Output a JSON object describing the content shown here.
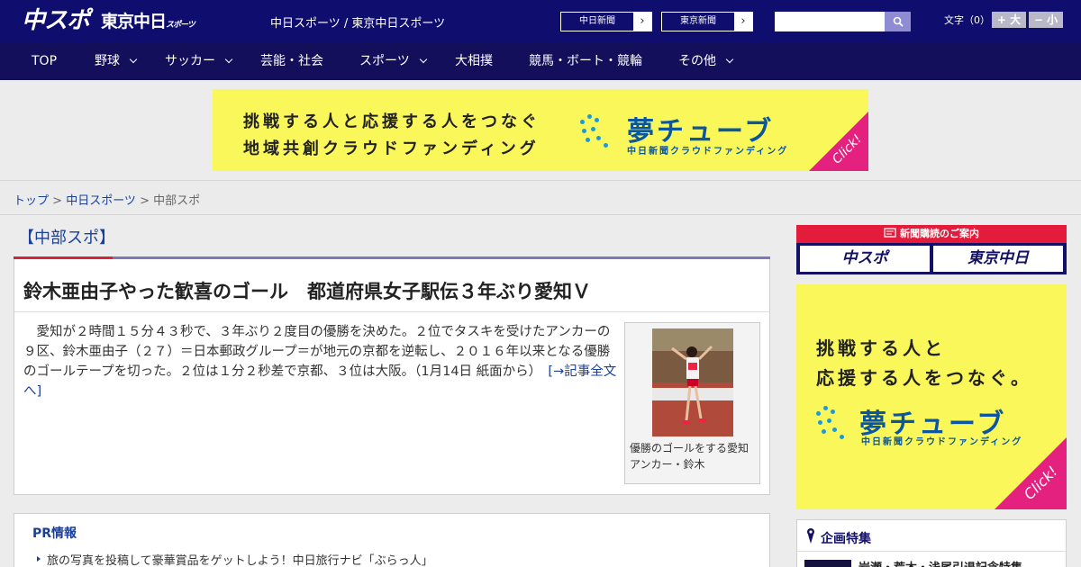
{
  "header": {
    "logo": "中スポ",
    "logo2_main": "東京中日",
    "logo2_small": "スポーツ",
    "site_links": "中日スポーツ / 東京中日スポーツ",
    "paper_buttons": [
      "中日新聞",
      "東京新聞"
    ],
    "font_label": "文字（0）",
    "font_larger": "+ 大",
    "font_smaller": "− 小"
  },
  "nav": {
    "items": [
      "TOP",
      "野球",
      "サッカー",
      "芸能・社会",
      "スポーツ",
      "大相撲",
      "競馬・ボート・競輪",
      "その他"
    ]
  },
  "banner": {
    "line1": "挑戦する人と応援する人をつなぐ",
    "line2": "地域共創クラウドファンディング",
    "brand": "夢チューブ",
    "brand_sub": "中日新聞クラウドファンディング",
    "click": "Click!"
  },
  "breadcrumb": {
    "top": "トップ",
    "sep": " > ",
    "chunichi": "中日スポーツ",
    "current": "中部スポ"
  },
  "section": {
    "label": "【中部スポ】"
  },
  "article": {
    "headline": "鈴木亜由子やった歓喜のゴール　都道府県女子駅伝３年ぶり愛知Ｖ",
    "body": "愛知が２時間１５分４３秒で、３年ぶり２度目の優勝を決めた。２位でタスキを受けたアンカーの９区、鈴木亜由子（２７）＝日本郵政グループ＝が地元の京都を逆転し、２０１６年以来となる優勝のゴールテープを切った。２位は１分２秒差で京都、３位は大阪。（1月14日 紙面から）",
    "read_more": "[→記事全文へ]",
    "photo_caption": "優勝のゴールをする愛知アンカー・鈴木"
  },
  "pr": {
    "title": "PR情報",
    "item": "旅の写真を投稿して豪華賞品をゲットしよう！中日旅行ナビ「ぶらっ人」"
  },
  "sidebar": {
    "subscribe_head": "新聞購読のご案内",
    "subscribe_left": "中スポ",
    "subscribe_right": "東京中日",
    "ad_line1": "挑戦する人と",
    "ad_line2": "応援する人をつなぐ。",
    "ad_brand": "夢チューブ",
    "ad_brand_sub": "中日新聞クラウドファンディング",
    "ad_click": "Click!",
    "kikaku_title": "企画特集",
    "kikaku_item": "岩瀬・荒木・浅尾引退記念特集"
  },
  "colors": {
    "header_bg": "#0f0d6e",
    "nav_bg": "#130f5b",
    "ad_yellow": "#faf75a",
    "ad_pink": "#e5217f",
    "accent_red": "#d5253b",
    "link_blue": "#1a3f9b"
  }
}
